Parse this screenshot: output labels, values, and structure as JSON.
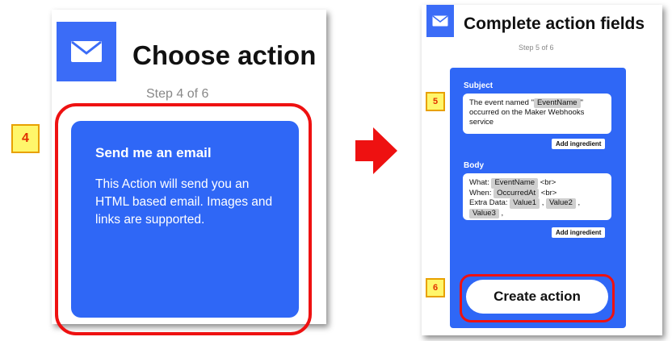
{
  "left": {
    "title": "Choose action",
    "step": "Step 4 of 6",
    "card_title": "Send me an email",
    "card_desc": "This Action will send you an HTML based email. Images and links are supported.",
    "badge": "4"
  },
  "right": {
    "title": "Complete action fields",
    "step": "Step 5 of 6",
    "subject_label": "Subject",
    "subject_prefix": "The event named \"",
    "subject_pill": "EventName",
    "subject_mid": "\"",
    "subject_suffix": "occurred on the Maker Webhooks service",
    "body_label": "Body",
    "body_what": "What:",
    "body_pill_eventname": "EventName",
    "body_br1": "<br>",
    "body_when": "When:",
    "body_pill_occurredat": "OccurredAt",
    "body_br2": "<br>",
    "body_extra": "Extra Data:",
    "body_pill_value1": "Value1",
    "body_pill_value2": "Value2",
    "body_pill_value3": "Value3",
    "body_comma": ",",
    "add_ingredient": "Add ingredient",
    "create_action": "Create action",
    "badge_5": "5",
    "badge_6": "6"
  },
  "colors": {
    "accent_blue": "#2f67f6",
    "highlight_red": "#ee1111",
    "badge_yellow": "#fff66b",
    "arrow_red": "#ee1111"
  },
  "icons": {
    "mail": "mail-icon",
    "arrow": "arrow-right-icon"
  }
}
